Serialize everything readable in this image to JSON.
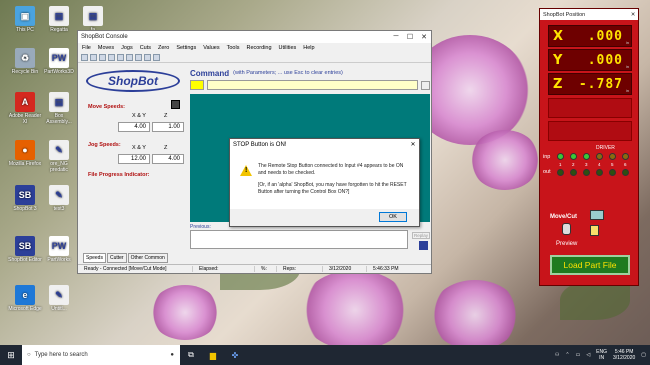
{
  "desktop": {
    "icons": [
      {
        "label": "This PC",
        "glyph": "▣",
        "color": "#4aa3df"
      },
      {
        "label": "Regatta",
        "glyph": "▤",
        "color": "#f0f0f0"
      },
      {
        "label": "fa",
        "glyph": "▤",
        "color": "#f0f0f0"
      },
      {
        "label": "Recycle Bin",
        "glyph": "♻",
        "color": "#9ab"
      },
      {
        "label": "PartWorks3D",
        "glyph": "PW",
        "color": "#ffffff"
      },
      {
        "label": "Adobe Reader XI",
        "glyph": "A",
        "color": "#d4281f"
      },
      {
        "label": "Box Assembly...",
        "glyph": "▤",
        "color": "#f0f0f0"
      },
      {
        "label": "Mozilla Firefox",
        "glyph": "●",
        "color": "#e66000"
      },
      {
        "label": "ore_NG predatic",
        "glyph": "✎",
        "color": "#f0f0f0"
      },
      {
        "label": "ShopBot 3",
        "glyph": "SB",
        "color": "#2c3f99"
      },
      {
        "label": "test3",
        "glyph": "✎",
        "color": "#f0f0f0"
      },
      {
        "label": "ShopBot Editor",
        "glyph": "SB",
        "color": "#2c3f99"
      },
      {
        "label": "PartWorks",
        "glyph": "PW",
        "color": "#ffffff"
      },
      {
        "label": "Microsoft Edge",
        "glyph": "e",
        "color": "#1e78d7"
      },
      {
        "label": "Untitl...",
        "glyph": "✎",
        "color": "#f0f0f0"
      }
    ]
  },
  "console": {
    "title": "ShopBot Console",
    "menu": [
      "File",
      "Moves",
      "Jogs",
      "Cuts",
      "Zero",
      "Settings",
      "Values",
      "Tools",
      "Recording",
      "Utilities",
      "Help"
    ],
    "logo": "ShopBot",
    "command_label": "Command",
    "command_hint": "(with Parameters; ... use Esc to clear entries)",
    "move_speeds_label": "Move Speeds:",
    "jog_speeds_label": "Jog Speeds:",
    "xy_header": "X & Y",
    "z_header": "Z",
    "move_xy": "4.00",
    "move_z": "1.00",
    "jog_xy": "12.00",
    "jog_z": "4.00",
    "file_progress_label": "File Progress Indicator:",
    "tabs": [
      "Speeds",
      "Cutter",
      "Other Common"
    ],
    "previous_label": "Previous:",
    "replay_label": "Replay",
    "status": {
      "mode": "Ready - Connected  [Move/Cut Mode]",
      "elapsed": "Elapsed:",
      "percent": "%:",
      "reps": "Reps:",
      "date": "3/12/2020",
      "time": "5:46:33 PM"
    }
  },
  "dialog": {
    "title": "STOP Button is ON!",
    "line1": "The Remote Stop Button connected to Input #4 appears to be ON and needs to be checked.",
    "line2": "[Or, if an 'alpha' ShopBot, you may have forgotten to hit the RESET Button after turning the Control Box ON?]",
    "ok_label": "OK"
  },
  "position": {
    "title": "ShopBot Position",
    "axes": [
      {
        "label": "X",
        "value": ".000",
        "unit": "in"
      },
      {
        "label": "Y",
        "value": ".000",
        "unit": "in"
      },
      {
        "label": "Z",
        "value": "-.787",
        "unit": "in"
      }
    ],
    "driver_label": "DRIVER",
    "inp_label": "inp",
    "out_label": "out",
    "numbers": [
      "1",
      "2",
      "3",
      "4",
      "5",
      "6"
    ],
    "move_cut_label": "Move/Cut",
    "preview_label": "Preview",
    "load_part_label": "Load Part File",
    "colors": {
      "led_on": "#38c838",
      "led_off": "#8a6a10",
      "led_out": "#2f4f10"
    }
  },
  "taskbar": {
    "search_placeholder": "Type here to search",
    "lang1": "ENG",
    "lang2": "IN",
    "time": "5:46 PM",
    "date": "3/12/2020"
  }
}
